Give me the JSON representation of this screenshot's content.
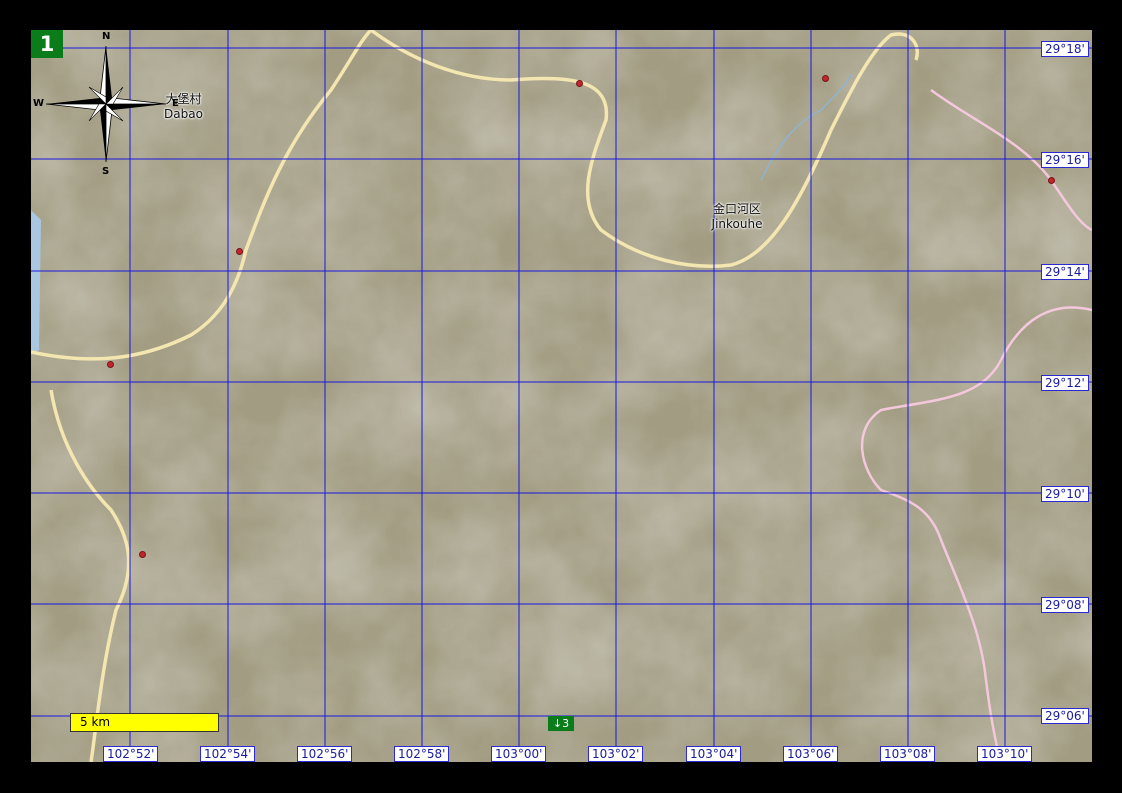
{
  "page": {
    "number": "1",
    "nav_label": "↓3"
  },
  "scale": {
    "label": "5 km"
  },
  "compass": {
    "n": "N",
    "s": "S",
    "e": "E",
    "w": "W"
  },
  "places": [
    {
      "id": "dabao",
      "native": "大堡村",
      "latin": "Dabao"
    },
    {
      "id": "jinkouhe",
      "native": "金口河区",
      "latin": "Jinkouhe"
    }
  ],
  "grid": {
    "latitudes": [
      "29°18'",
      "29°16'",
      "29°14'",
      "29°12'",
      "29°10'",
      "29°08'",
      "29°06'"
    ],
    "longitudes": [
      "102°52'",
      "102°54'",
      "102°56'",
      "102°58'",
      "103°00'",
      "103°02'",
      "103°04'",
      "103°06'",
      "103°08'",
      "103°10'"
    ]
  },
  "colors": {
    "grid": "#1818e0",
    "road": "#f3e6b0",
    "border": "#f4c8dc",
    "badge": "#0a7d1a",
    "scalebar": "#ffff00"
  }
}
